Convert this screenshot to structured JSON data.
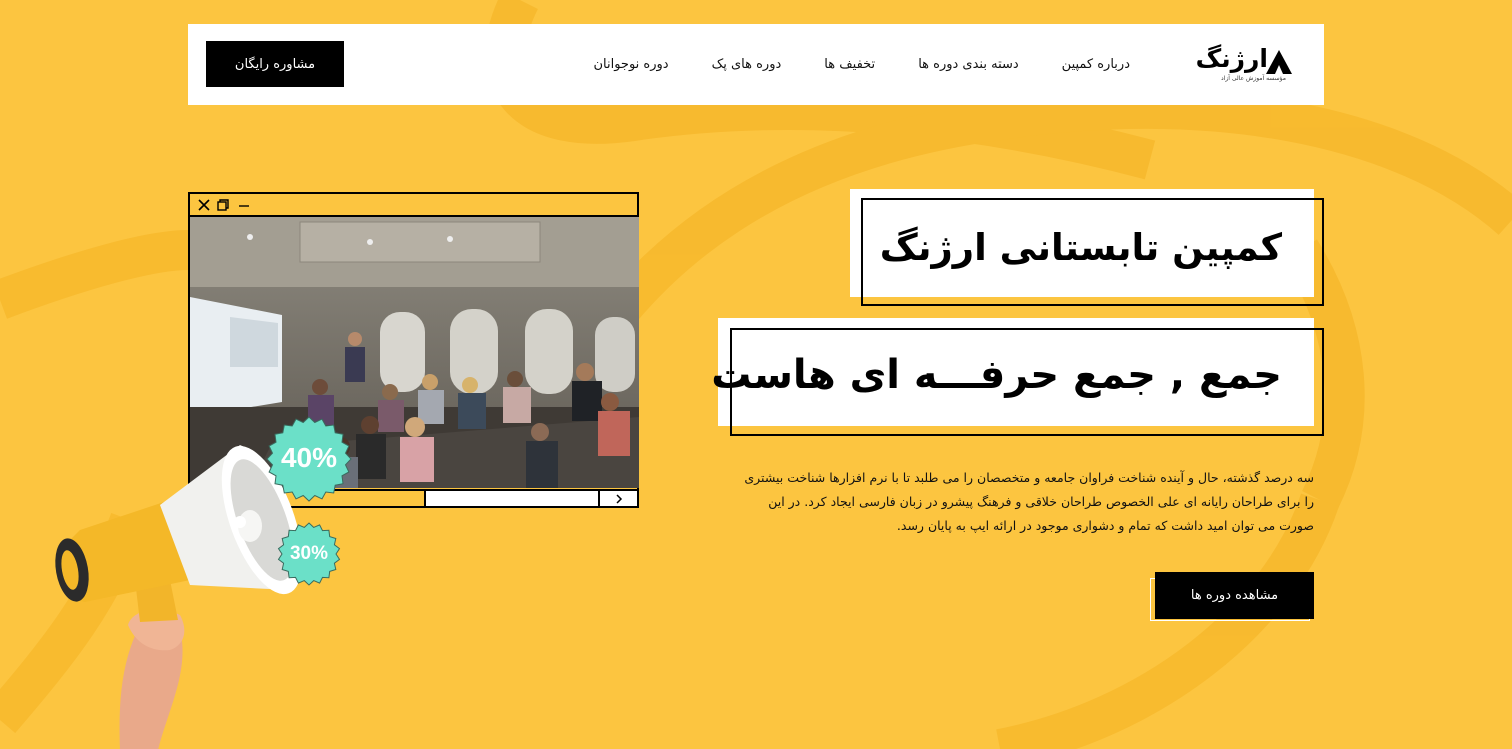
{
  "header": {
    "logo_text": "ارژنگ",
    "logo_sub": "مؤسسه آموزش عالی آزاد",
    "cta_label": "مشاوره رایگان",
    "nav": [
      {
        "label": "درباره کمپین"
      },
      {
        "label": "دسته بندی دوره ها"
      },
      {
        "label": "تخفیف ها"
      },
      {
        "label": "دوره های پک"
      },
      {
        "label": "دوره نوجوانان"
      }
    ]
  },
  "hero": {
    "title_line1": "کمپین تابستانی ارژنگ",
    "title_line2": "جمع , جمع حرفـــه ای هاست",
    "description": "سه درصد گذشته، حال و آینده شناخت فراوان جامعه و متخصصان را می طلبد تا با نرم افزارها شناخت بیشتری را برای طراحان رایانه ای علی الخصوص طراحان خلاقی و فرهنگ پیشرو در زبان فارسی ایجاد کرد. در این صورت می توان امید داشت که تمام و دشواری موجود در ارائه ایپ به پایان رسد.",
    "button_label": "مشاهده دوره ها"
  },
  "window": {
    "icons": [
      "close-icon",
      "restore-icon",
      "minimize-icon",
      "chevron-right-icon"
    ]
  },
  "badges": {
    "large": "40%",
    "small": "30%",
    "color": "#6be0c8"
  },
  "colors": {
    "background": "#fcc540",
    "accent": "#000000",
    "panel": "#ffffff"
  }
}
